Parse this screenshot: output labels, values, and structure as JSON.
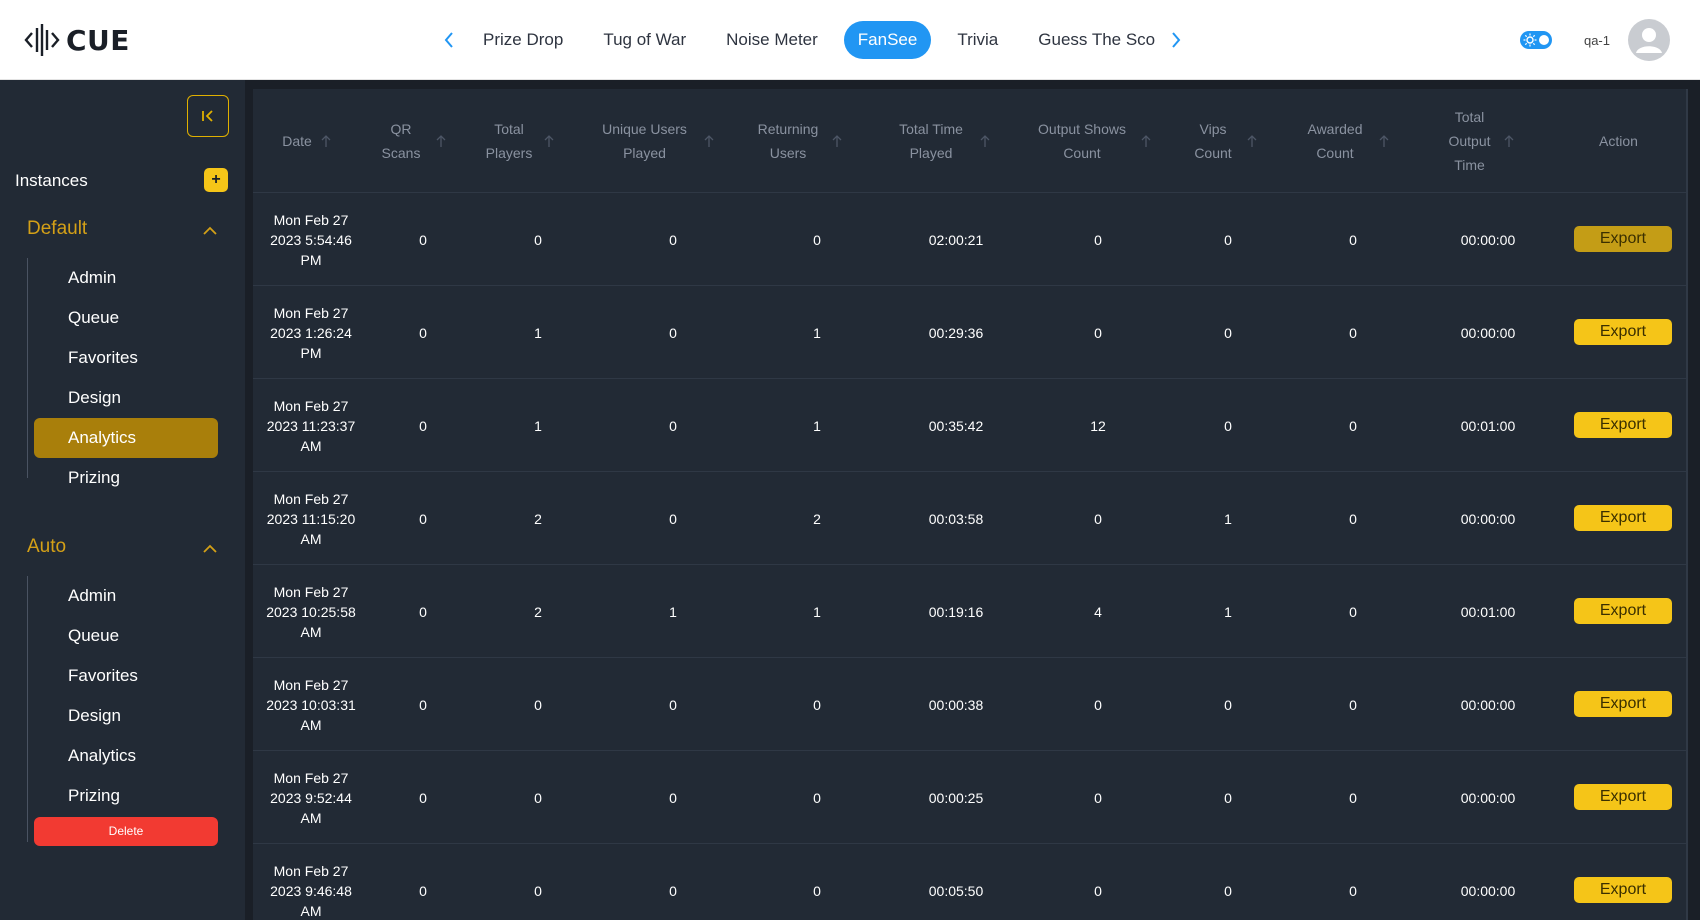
{
  "app": {
    "logo_text": "CUE"
  },
  "header": {
    "tabs": [
      {
        "label": "Prize Drop"
      },
      {
        "label": "Tug of War"
      },
      {
        "label": "Noise Meter"
      },
      {
        "label": "FanSee",
        "active": true
      },
      {
        "label": "Trivia"
      },
      {
        "label": "Guess The Score"
      }
    ],
    "username": "qa-1",
    "accent_color": "#2196f3"
  },
  "sidebar": {
    "instances_label": "Instances",
    "add_label": "+",
    "groups": [
      {
        "title": "Default",
        "items": [
          "Admin",
          "Queue",
          "Favorites",
          "Design",
          "Analytics",
          "Prizing"
        ],
        "active": "Analytics"
      },
      {
        "title": "Auto",
        "items": [
          "Admin",
          "Queue",
          "Favorites",
          "Design",
          "Analytics",
          "Prizing"
        ]
      }
    ],
    "delete_label": "Delete",
    "accent_color": "#f5c518"
  },
  "table": {
    "columns": [
      {
        "label": "Date"
      },
      {
        "label": "QR Scans"
      },
      {
        "label": "Total Players"
      },
      {
        "label": "Unique Users Played"
      },
      {
        "label": "Returning Users"
      },
      {
        "label": "Total Time Played"
      },
      {
        "label": "Output Shows Count"
      },
      {
        "label": "Vips Count"
      },
      {
        "label": "Awarded Count"
      },
      {
        "label": "Total Output Time"
      },
      {
        "label": "Action"
      }
    ],
    "action_label": "Export",
    "rows": [
      {
        "date": "Mon Feb 27 2023 5:54:46 PM",
        "qr": "0",
        "total_players": "0",
        "unique": "0",
        "returning": "0",
        "time_played": "02:00:21",
        "output_shows": "0",
        "vips": "0",
        "awarded": "0",
        "output_time": "00:00:00"
      },
      {
        "date": "Mon Feb 27 2023 1:26:24 PM",
        "qr": "0",
        "total_players": "1",
        "unique": "0",
        "returning": "1",
        "time_played": "00:29:36",
        "output_shows": "0",
        "vips": "0",
        "awarded": "0",
        "output_time": "00:00:00"
      },
      {
        "date": "Mon Feb 27 2023 11:23:37 AM",
        "qr": "0",
        "total_players": "1",
        "unique": "0",
        "returning": "1",
        "time_played": "00:35:42",
        "output_shows": "12",
        "vips": "0",
        "awarded": "0",
        "output_time": "00:01:00"
      },
      {
        "date": "Mon Feb 27 2023 11:15:20 AM",
        "qr": "0",
        "total_players": "2",
        "unique": "0",
        "returning": "2",
        "time_played": "00:03:58",
        "output_shows": "0",
        "vips": "1",
        "awarded": "0",
        "output_time": "00:00:00"
      },
      {
        "date": "Mon Feb 27 2023 10:25:58 AM",
        "qr": "0",
        "total_players": "2",
        "unique": "1",
        "returning": "1",
        "time_played": "00:19:16",
        "output_shows": "4",
        "vips": "1",
        "awarded": "0",
        "output_time": "00:01:00"
      },
      {
        "date": "Mon Feb 27 2023 10:03:31 AM",
        "qr": "0",
        "total_players": "0",
        "unique": "0",
        "returning": "0",
        "time_played": "00:00:38",
        "output_shows": "0",
        "vips": "0",
        "awarded": "0",
        "output_time": "00:00:00"
      },
      {
        "date": "Mon Feb 27 2023 9:52:44 AM",
        "qr": "0",
        "total_players": "0",
        "unique": "0",
        "returning": "0",
        "time_played": "00:00:25",
        "output_shows": "0",
        "vips": "0",
        "awarded": "0",
        "output_time": "00:00:00"
      },
      {
        "date": "Mon Feb 27 2023 9:46:48 AM",
        "qr": "0",
        "total_players": "0",
        "unique": "0",
        "returning": "0",
        "time_played": "00:05:50",
        "output_shows": "0",
        "vips": "0",
        "awarded": "0",
        "output_time": "00:00:00"
      }
    ]
  }
}
